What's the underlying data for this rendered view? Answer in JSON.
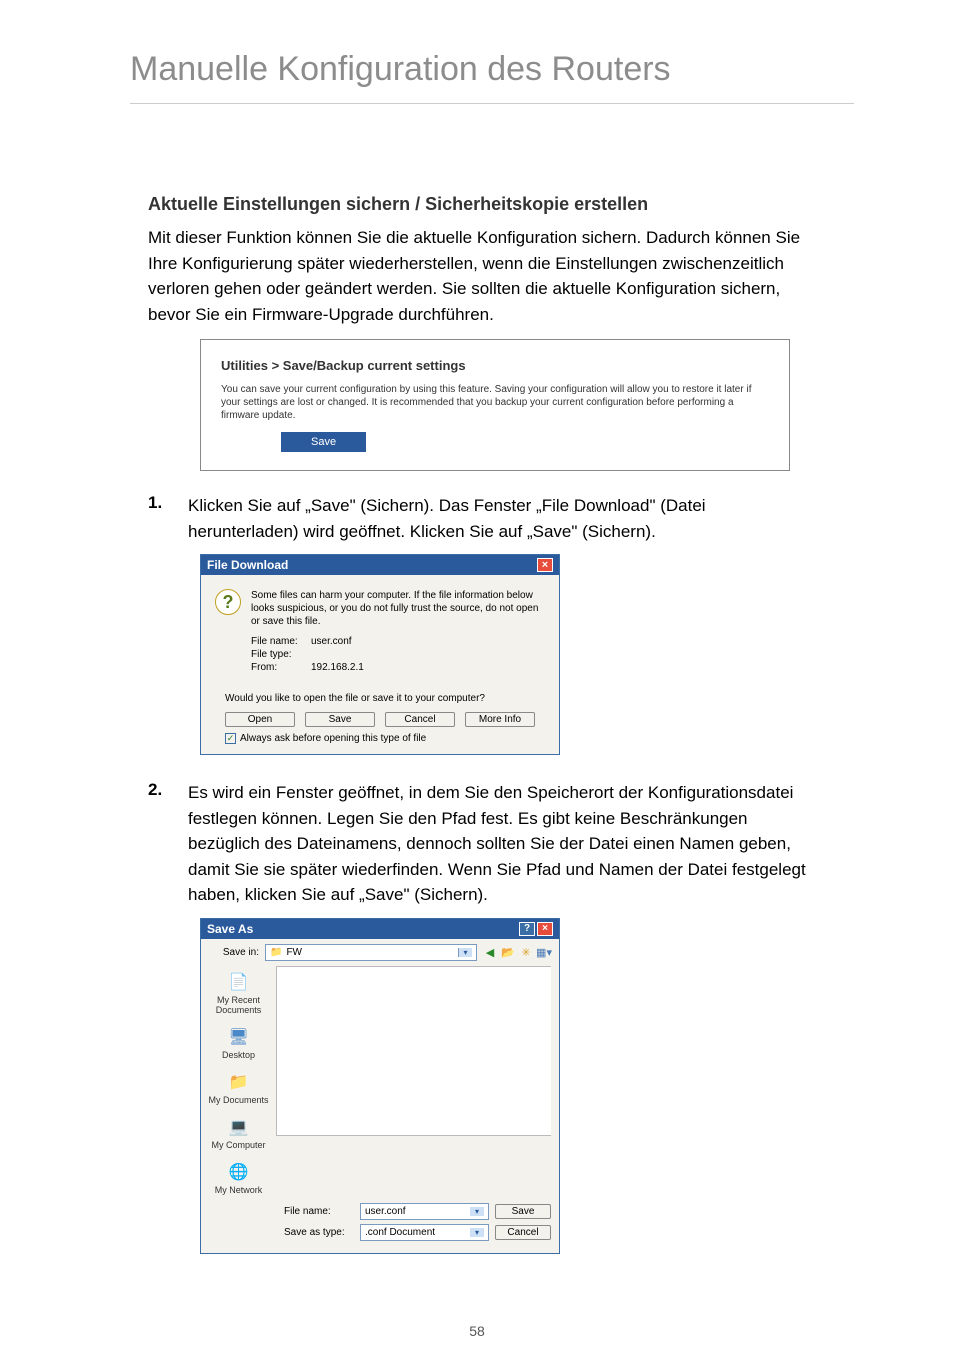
{
  "page": {
    "title": "Manuelle Konfiguration des Routers",
    "number": "58"
  },
  "section": {
    "heading": "Aktuelle Einstellungen sichern / Sicherheitskopie erstellen",
    "intro": "Mit dieser Funktion können Sie die aktuelle Konfiguration sichern. Dadurch können Sie Ihre Konfigurierung später wiederherstellen, wenn die Einstellungen zwischenzeitlich verloren gehen oder geändert werden. Sie sollten die aktuelle Konfiguration sichern, bevor Sie ein Firmware-Upgrade durchführen."
  },
  "utilities_panel": {
    "title": "Utilities > Save/Backup current settings",
    "description": "You can save your current configuration by using this feature. Saving your configuration will allow you to restore it later if your settings are lost or changed. It is recommended that you backup your current configuration before performing a firmware update.",
    "save_button": "Save"
  },
  "steps": {
    "s1": {
      "num": "1.",
      "text": "Klicken Sie auf „Save\" (Sichern). Das Fenster „File Download\" (Datei herunterladen) wird geöffnet. Klicken Sie auf „Save\" (Sichern)."
    },
    "s2": {
      "num": "2.",
      "text": "Es wird ein Fenster geöffnet, in dem Sie den Speicherort der Konfigurationsdatei festlegen können. Legen Sie den Pfad fest. Es gibt keine Beschränkungen bezüglich des Dateinamens, dennoch sollten Sie der Datei einen Namen geben, damit Sie sie später wiederfinden. Wenn Sie Pfad und Namen der Datei festgelegt haben, klicken Sie auf „Save\" (Sichern)."
    }
  },
  "file_download": {
    "title": "File Download",
    "warning": "Some files can harm your computer. If the file information below looks suspicious, or you do not fully trust the source, do not open or save this file.",
    "filename_label": "File name:",
    "filename_value": "user.conf",
    "filetype_label": "File type:",
    "filetype_value": "",
    "from_label": "From:",
    "from_value": "192.168.2.1",
    "question": "Would you like to open the file or save it to your computer?",
    "open": "Open",
    "save": "Save",
    "cancel": "Cancel",
    "more_info": "More Info",
    "always_ask": "Always ask before opening this type of file"
  },
  "save_as": {
    "title": "Save As",
    "save_in_label": "Save in:",
    "save_in_value": "FW",
    "sidebar": {
      "recent": "My Recent Documents",
      "desktop": "Desktop",
      "mydocs": "My Documents",
      "mycomp": "My Computer",
      "mynet": "My Network"
    },
    "filename_label": "File name:",
    "filename_value": "user.conf",
    "saveastype_label": "Save as type:",
    "saveastype_value": ".conf Document",
    "save_btn": "Save",
    "cancel_btn": "Cancel"
  }
}
